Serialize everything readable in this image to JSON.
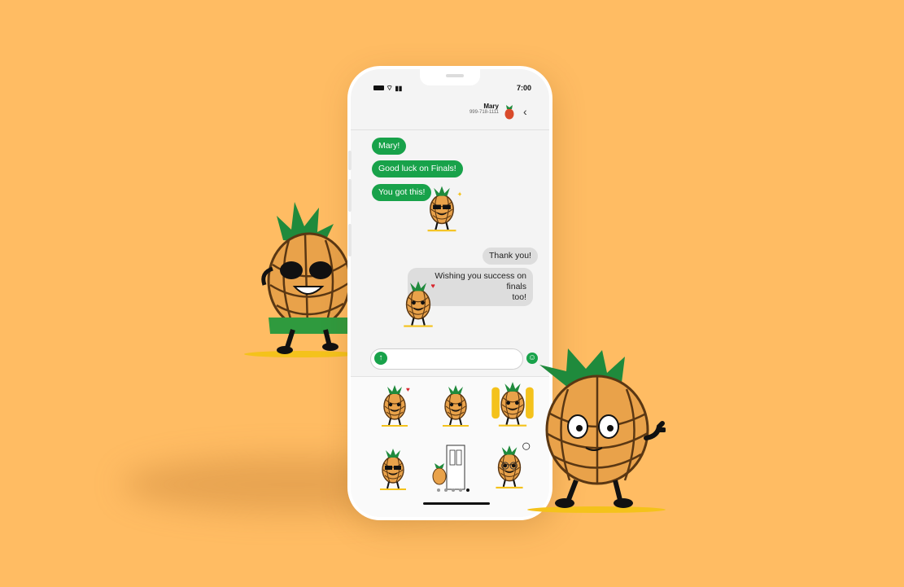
{
  "colors": {
    "background": "#FFBC63",
    "outgoing_bubble": "#18A24A",
    "incoming_bubble": "#DDDDDD",
    "pineapple": "#E9A24A",
    "leaves": "#1F8A3C"
  },
  "status_bar": {
    "time": "7:00"
  },
  "contact": {
    "name": "Mary",
    "phone": "999-718-1111"
  },
  "messages": [
    {
      "text": "Mary!",
      "side": "outgoing"
    },
    {
      "text": "Good luck on Finals!",
      "side": "outgoing"
    },
    {
      "text": "You got this!",
      "side": "outgoing"
    },
    {
      "sticker": "pineapple-sunglasses-sticker",
      "side": "outgoing"
    },
    {
      "text": "Thank you!",
      "side": "incoming"
    },
    {
      "text": "Wishing you success on finals",
      "text2": "too!",
      "side": "incoming"
    },
    {
      "sticker": "pineapple-blushing-sticker",
      "side": "incoming"
    }
  ],
  "sticker_tray": {
    "stickers": [
      "pineapple-heart-eyes-sticker",
      "pineapple-sleepy-sticker",
      "pineapple-band-sticker",
      "pineapple-sunglasses-sticker",
      "pineapple-door-sticker",
      "pineapple-glasses-sticker"
    ],
    "page_count": 5,
    "active_page": 0
  },
  "icons": {
    "back": "chevron-left-icon",
    "send": "arrow-up-icon",
    "sticker": "smiley-icon",
    "avatar": "pineapple-avatar"
  }
}
